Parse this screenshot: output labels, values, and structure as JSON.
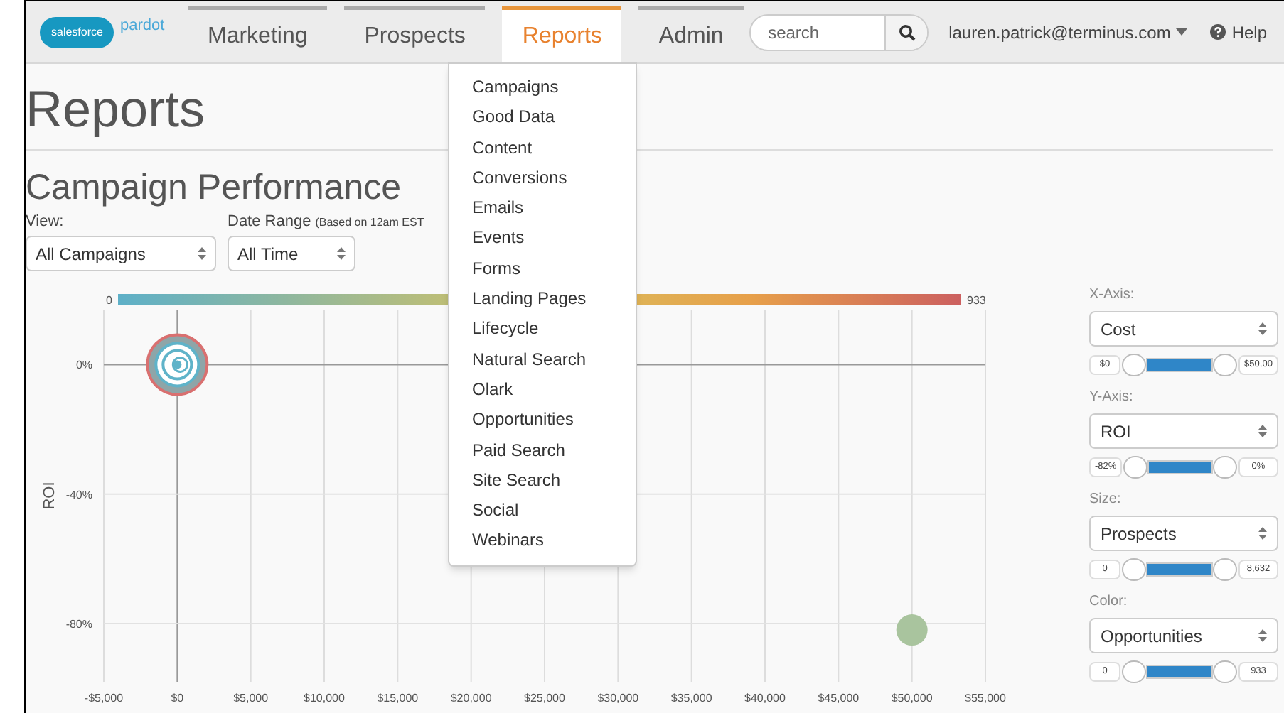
{
  "nav": {
    "logo": {
      "cloud": "salesforce",
      "product": "pardot"
    },
    "tabs": [
      {
        "label": "Marketing",
        "selected": false
      },
      {
        "label": "Prospects",
        "selected": false
      },
      {
        "label": "Reports",
        "selected": true
      },
      {
        "label": "Admin",
        "selected": false
      }
    ],
    "search": {
      "placeholder": "search"
    },
    "user": "lauren.patrick@terminus.com",
    "help": "Help"
  },
  "page_title": "Reports",
  "section_title": "Campaign Performance",
  "filters": [
    {
      "label": "View:",
      "value": "All Campaigns"
    },
    {
      "label": "Date Range",
      "note": "(Based on 12am EST",
      "value": "All Time"
    }
  ],
  "reports_menu": [
    "Campaigns",
    "Good Data",
    "Content",
    "Conversions",
    "Emails",
    "Events",
    "Forms",
    "Landing Pages",
    "Lifecycle",
    "Natural Search",
    "Olark",
    "Opportunities",
    "Paid Search",
    "Site Search",
    "Social",
    "Webinars"
  ],
  "chart": {
    "color_scale": {
      "min_label": "0",
      "max_label": "933"
    },
    "chart_data": {
      "type": "scatter",
      "ylabel": "ROI",
      "xlim": [
        -5000,
        55000
      ],
      "ylim": [
        -98,
        17
      ],
      "grid": true,
      "xticks": [
        {
          "value": -5000,
          "label": "-$5,000"
        },
        {
          "value": 0,
          "label": "$0"
        },
        {
          "value": 5000,
          "label": "$5,000"
        },
        {
          "value": 10000,
          "label": "$10,000"
        },
        {
          "value": 15000,
          "label": "$15,000"
        },
        {
          "value": 20000,
          "label": "$20,000"
        },
        {
          "value": 25000,
          "label": "$25,000"
        },
        {
          "value": 30000,
          "label": "$30,000"
        },
        {
          "value": 35000,
          "label": "$35,000"
        },
        {
          "value": 40000,
          "label": "$40,000"
        },
        {
          "value": 45000,
          "label": "$45,000"
        },
        {
          "value": 50000,
          "label": "$50,000"
        },
        {
          "value": 55000,
          "label": "$55,000"
        }
      ],
      "yticks": [
        {
          "value": 0,
          "label": "0%"
        },
        {
          "value": -40,
          "label": "-40%"
        },
        {
          "value": -80,
          "label": "-80%"
        }
      ],
      "series": [
        {
          "color": "#5fb3c9",
          "x": [
            0
          ],
          "values": [
            0
          ]
        },
        {
          "color": "#a9c49e",
          "x": [
            50000
          ],
          "values": [
            -82
          ]
        }
      ]
    }
  },
  "controls": [
    {
      "label": "X-Axis:",
      "value": "Cost",
      "min_label": "$0",
      "max_label": "$50,00",
      "level": 1
    },
    {
      "label": "Y-Axis:",
      "value": "ROI",
      "min_label": "-82%",
      "max_label": "0%",
      "level": 1
    },
    {
      "label": "Size:",
      "value": "Prospects",
      "min_label": "0",
      "max_label": "8,632",
      "level": 1
    },
    {
      "label": "Color:",
      "value": "Opportunities",
      "min_label": "0",
      "max_label": "933",
      "level": 1
    }
  ]
}
